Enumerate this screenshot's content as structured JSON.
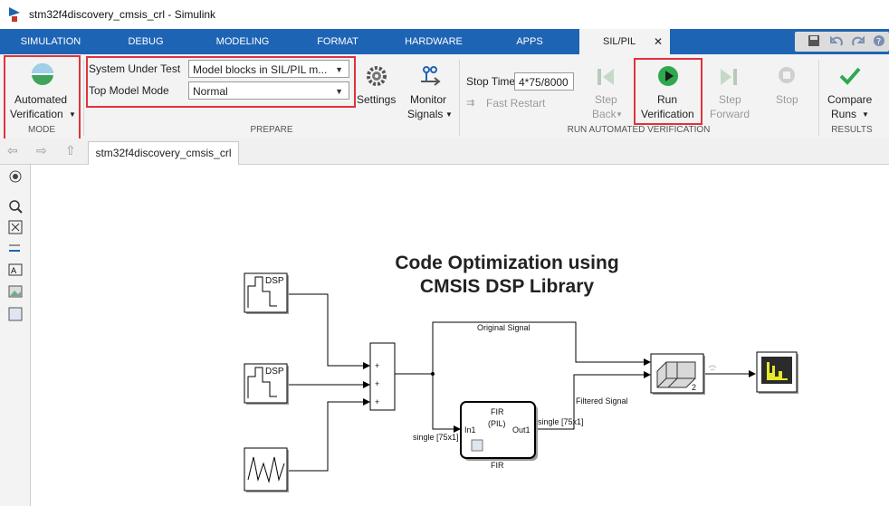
{
  "window": {
    "title": "stm32f4discovery_cmsis_crl - Simulink"
  },
  "tabs": [
    {
      "label": "SIMULATION"
    },
    {
      "label": "DEBUG"
    },
    {
      "label": "MODELING"
    },
    {
      "label": "FORMAT"
    },
    {
      "label": "HARDWARE"
    },
    {
      "label": "APPS"
    },
    {
      "label": "SIL/PIL",
      "active": true
    }
  ],
  "mode": {
    "button_line1": "Automated",
    "button_line2": "Verification",
    "section": "MODE"
  },
  "prepare": {
    "sut_label": "System Under Test",
    "sut_value": "Model blocks in SIL/PIL m...",
    "tmm_label": "Top Model Mode",
    "tmm_value": "Normal",
    "settings_label": "Settings",
    "monitor_line1": "Monitor",
    "monitor_line2": "Signals",
    "section": "PREPARE"
  },
  "run": {
    "stop_time_label": "Stop Time",
    "stop_time_value": "4*75/8000",
    "fast_restart": "Fast Restart",
    "step_back_1": "Step",
    "step_back_2": "Back",
    "run_1": "Run",
    "run_2": "Verification",
    "step_fwd_1": "Step",
    "step_fwd_2": "Forward",
    "stop": "Stop",
    "section": "RUN AUTOMATED VERIFICATION"
  },
  "results": {
    "compare_1": "Compare",
    "compare_2": "Runs",
    "section": "RESULTS"
  },
  "doc_tab": "stm32f4discovery_cmsis_crl",
  "diagram": {
    "title_line1": "Code Optimization using",
    "title_line2": "CMSIS DSP Library",
    "src_label": "DSP",
    "sum_plus": "+",
    "fir_name": "FIR",
    "fir_line1": "FIR",
    "fir_line2": "(PIL)",
    "fir_in": "In1",
    "fir_out": "Out1",
    "original_signal": "Original Signal",
    "filtered_signal": "Filtered Signal",
    "sig_in": "single [75x1]",
    "sig_out": "single [75x1]",
    "concat_count": "2"
  },
  "colors": {
    "accent": "#1e64b4",
    "highlight": "#e0333b",
    "run_green": "#2fa84f",
    "scope_yellow": "#e8e82a"
  }
}
